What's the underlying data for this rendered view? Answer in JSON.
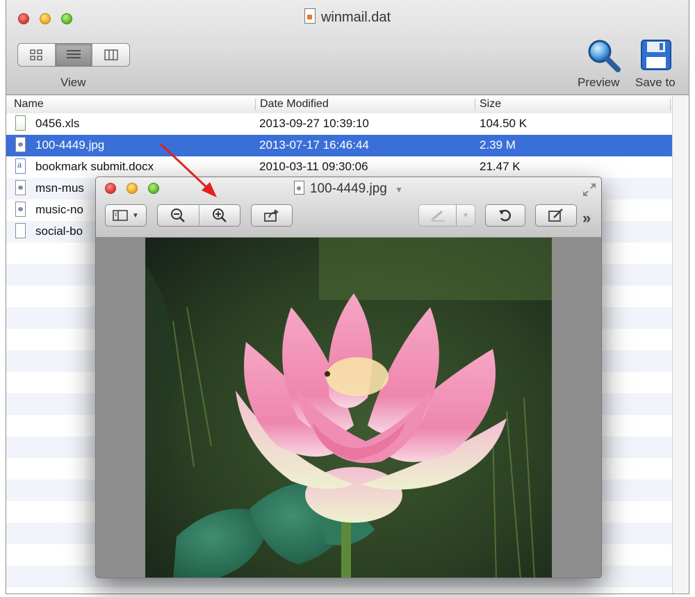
{
  "window": {
    "title": "winmail.dat",
    "view_label": "View",
    "preview_label": "Preview",
    "save_label": "Save to"
  },
  "columns": {
    "name": "Name",
    "date": "Date Modified",
    "size": "Size"
  },
  "files": [
    {
      "name": "0456.xls",
      "date": "2013-09-27 10:39:10",
      "size": "104.50 K",
      "icon": "spreadsheet-icon"
    },
    {
      "name": "100-4449.jpg",
      "date": "2013-07-17 16:46:44",
      "size": "2.39 M",
      "icon": "image-file-icon",
      "selected": true
    },
    {
      "name": "bookmark submit.docx",
      "date": "2010-03-11 09:30:06",
      "size": "21.47 K",
      "icon": "word-document-icon"
    },
    {
      "name": "msn-mus",
      "icon": "image-file-icon"
    },
    {
      "name": "music-no",
      "icon": "image-file-icon"
    },
    {
      "name": "social-bo",
      "icon": "document-icon"
    }
  ],
  "quicklook": {
    "title": "100-4449.jpg",
    "content": "photo of a pink lotus flower"
  },
  "colors": {
    "selection": "#3a6fd8",
    "annotation_arrow": "#e3211c"
  }
}
